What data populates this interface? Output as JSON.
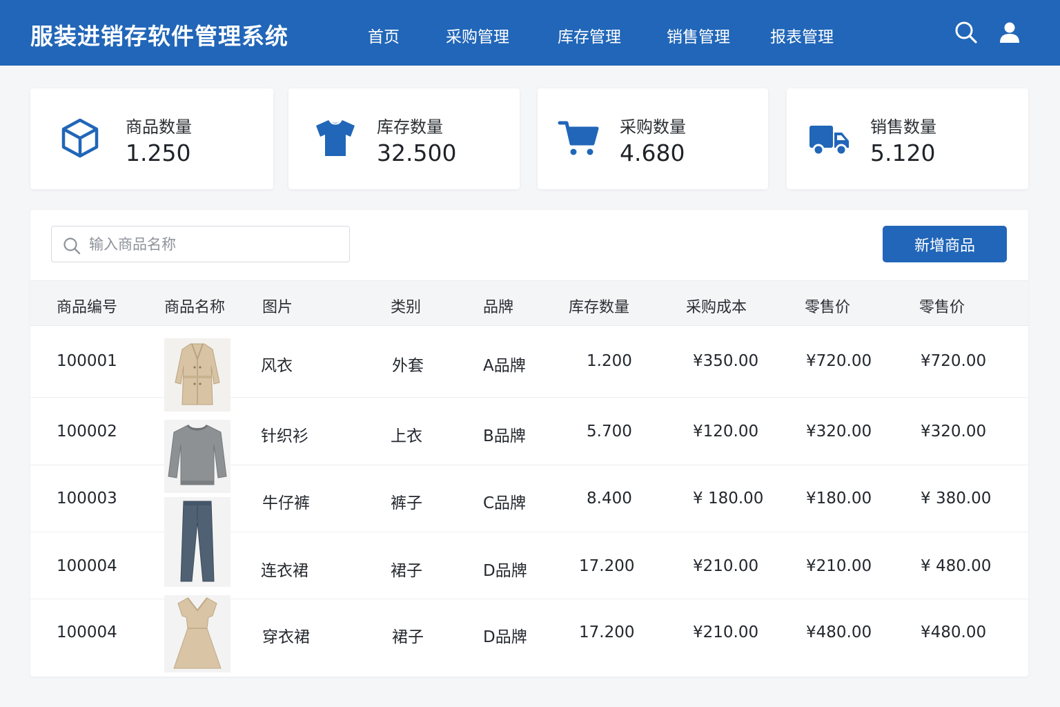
{
  "header": {
    "title": "服装进销存软件管理系统",
    "nav": [
      "首页",
      "采购管理",
      "库存管理",
      "销售管理",
      "报表管理"
    ],
    "search_icon": "search-icon",
    "user_icon": "user-icon"
  },
  "stats": [
    {
      "icon": "box-icon",
      "label": "商品数量",
      "value": "1.250"
    },
    {
      "icon": "tshirt-icon",
      "label": "库存数量",
      "value": "32.500"
    },
    {
      "icon": "cart-icon",
      "label": "采购数量",
      "value": "4.680"
    },
    {
      "icon": "truck-icon",
      "label": "销售数量",
      "value": "5.120"
    }
  ],
  "toolbar": {
    "search_placeholder": "输入商品名称",
    "add_button": "新增商品"
  },
  "table": {
    "columns": [
      "商品编号",
      "商品名称",
      "图片",
      "类别",
      "品牌",
      "库存数量",
      "采购成本",
      "零售价",
      "零售价"
    ],
    "rows": [
      {
        "id": "100001",
        "image": "trench-coat",
        "name": "风衣",
        "category": "外套",
        "brand": "A品牌",
        "stock": "1.200",
        "cost": "¥350.00",
        "price1": "¥720.00",
        "price2": "¥720.00"
      },
      {
        "id": "100002",
        "image": "sweater",
        "name": "针织衫",
        "category": "上衣",
        "brand": "B品牌",
        "stock": "5.700",
        "cost": "¥120.00",
        "price1": "¥320.00",
        "price2": "¥320.00"
      },
      {
        "id": "100003",
        "image": "jeans",
        "name": "牛仔裤",
        "category": "裤子",
        "brand": "C品牌",
        "stock": "8.400",
        "cost": "¥ 180.00",
        "price1": "¥180.00",
        "price2": "¥ 380.00"
      },
      {
        "id": "100004",
        "image": "jeans",
        "name": "连衣裙",
        "category": "裙子",
        "brand": "D品牌",
        "stock": "17.200",
        "cost": "¥210.00",
        "price1": "¥210.00",
        "price2": "¥ 480.00"
      },
      {
        "id": "100004",
        "image": "dress",
        "name": "穿衣裙",
        "category": "裙子",
        "brand": "D品牌",
        "stock": "17.200",
        "cost": "¥210.00",
        "price1": "¥480.00",
        "price2": "¥480.00"
      }
    ]
  },
  "colors": {
    "primary": "#2166b8",
    "background": "#f5f6f8"
  }
}
